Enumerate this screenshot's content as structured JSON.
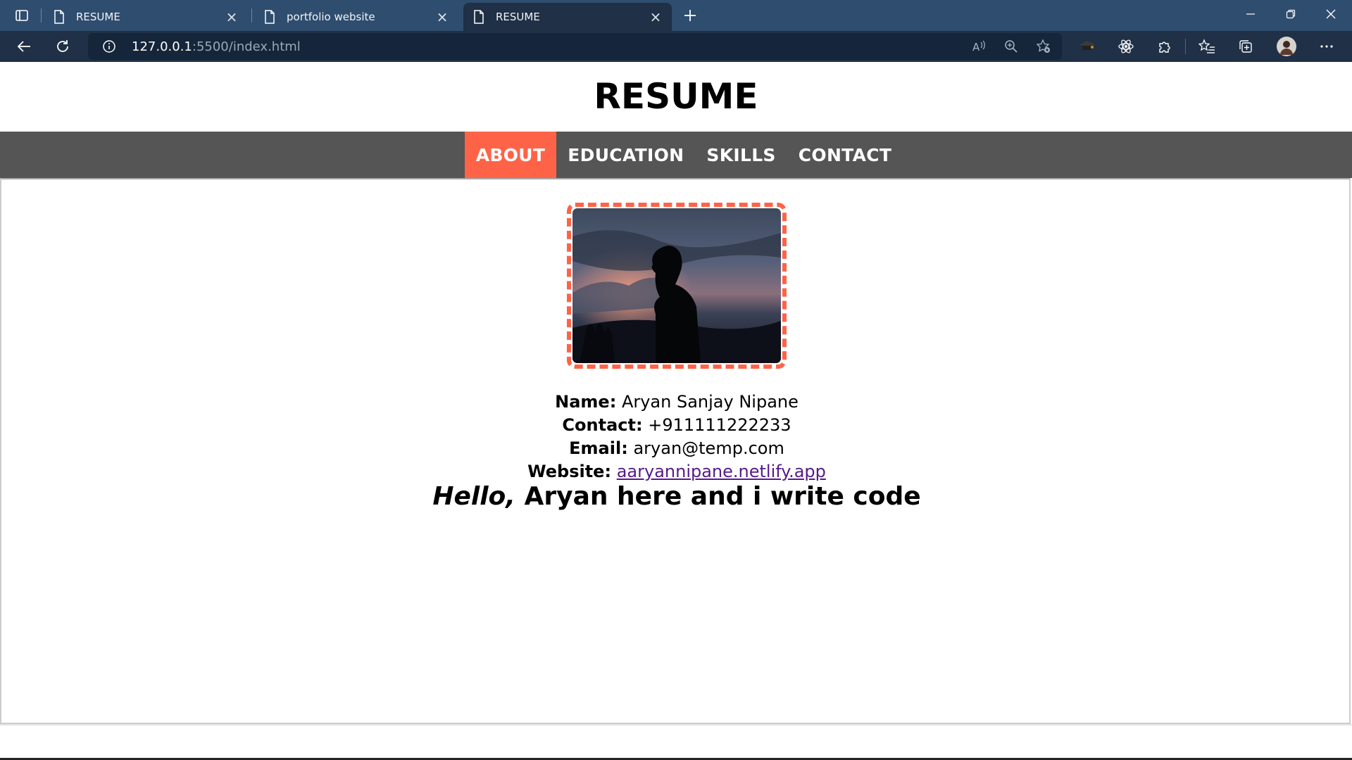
{
  "browser": {
    "tabs": [
      {
        "label": "RESUME",
        "active": false
      },
      {
        "label": "portfolio website",
        "active": false
      },
      {
        "label": "RESUME",
        "active": true
      }
    ],
    "address": {
      "host": "127.0.0.1",
      "rest": ":5500/index.html"
    },
    "colors": {
      "tabstrip": "#2f4d6e",
      "toolbar": "#1f3047",
      "address_bg": "#15253a"
    }
  },
  "page": {
    "title": "RESUME",
    "nav": [
      {
        "label": "ABOUT",
        "active": true
      },
      {
        "label": "EDUCATION",
        "active": false
      },
      {
        "label": "SKILLS",
        "active": false
      },
      {
        "label": "CONTACT",
        "active": false
      }
    ],
    "accent": "#ff6347",
    "nav_bg": "#555555",
    "info": {
      "name_label": "Name:",
      "name_value": "Aryan Sanjay Nipane",
      "contact_label": "Contact:",
      "contact_value": "+911111222233",
      "email_label": "Email:",
      "email_value": "aryan@temp.com",
      "website_label": "Website:",
      "website_value": "aaryannipane.netlify.app"
    },
    "hello_em": "Hello,",
    "hello_rest": " Aryan here and i write code"
  }
}
